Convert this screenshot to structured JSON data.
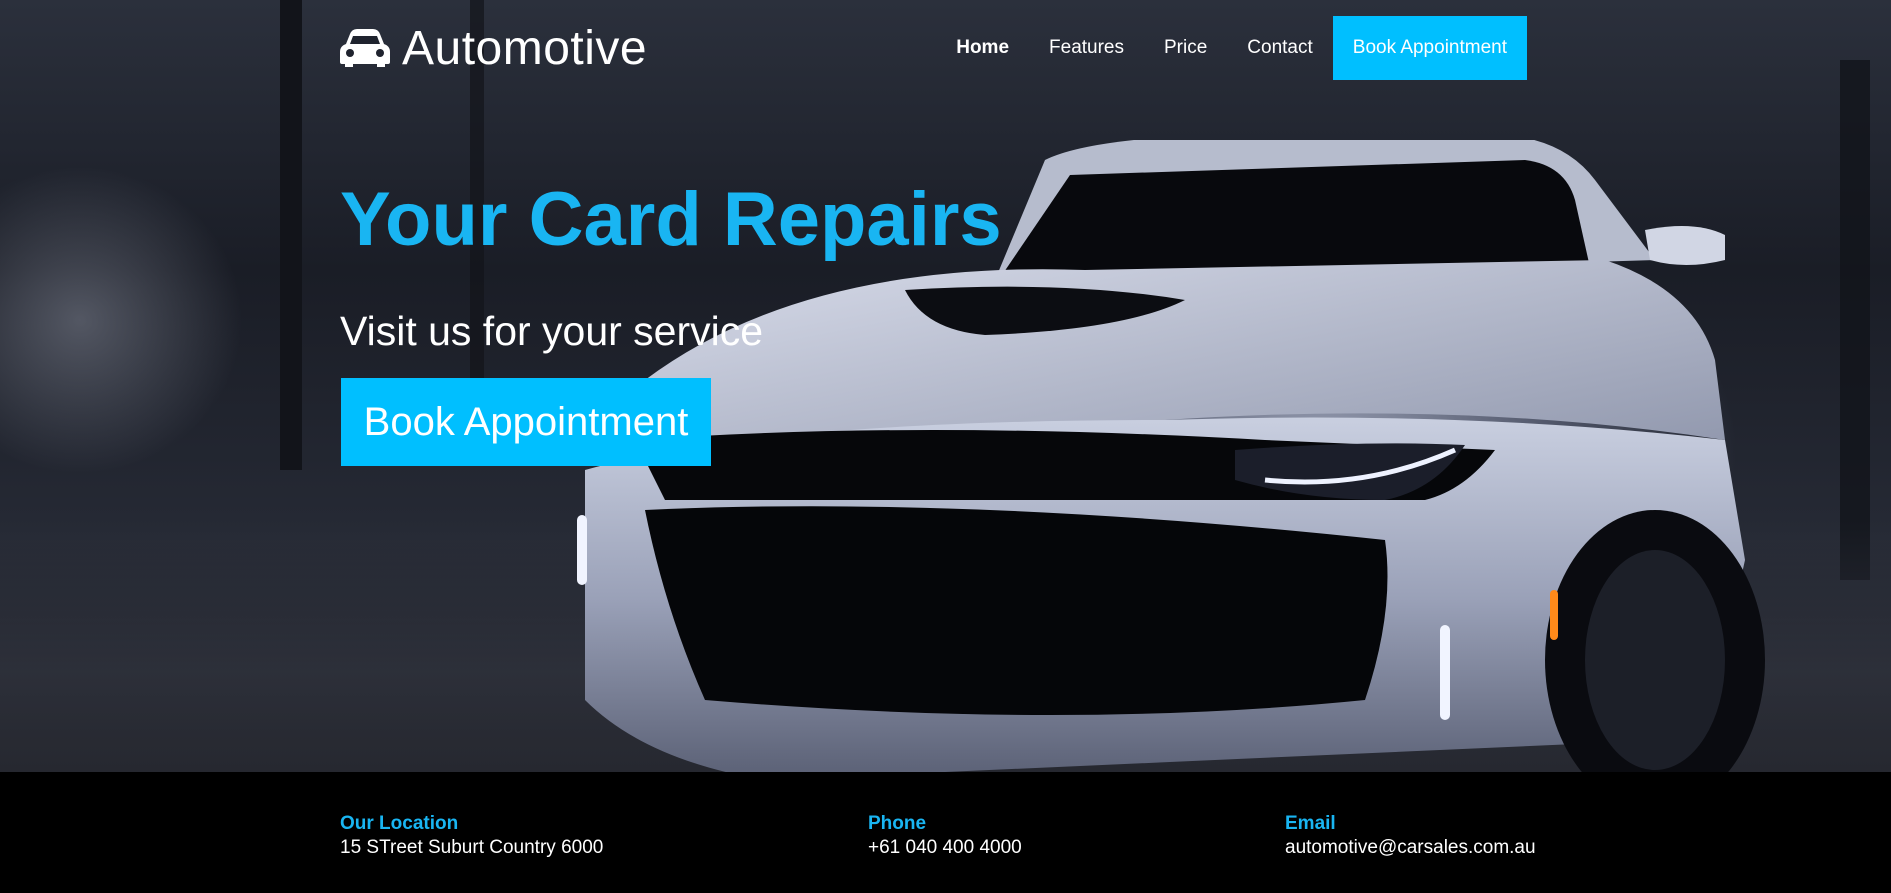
{
  "brand": {
    "name": "Automotive",
    "icon": "car-icon"
  },
  "nav": {
    "links": [
      {
        "label": "Home",
        "active": true
      },
      {
        "label": "Features",
        "active": false
      },
      {
        "label": "Price",
        "active": false
      },
      {
        "label": "Contact",
        "active": false
      }
    ],
    "cta_label": "Book Appointment"
  },
  "hero": {
    "title": "Your Card Repairs",
    "subtitle": "Visit us for your service",
    "cta_label": "Book Appointment"
  },
  "footer": {
    "location": {
      "label": "Our Location",
      "value": "15 STreet Suburt Country 6000"
    },
    "phone": {
      "label": "Phone",
      "value": "+61 040 400 4000"
    },
    "email": {
      "label": "Email",
      "value": "automotive@carsales.com.au"
    }
  },
  "colors": {
    "accent": "#00bfff",
    "accent_text": "#19b5f2",
    "footer_bg": "#000000"
  }
}
